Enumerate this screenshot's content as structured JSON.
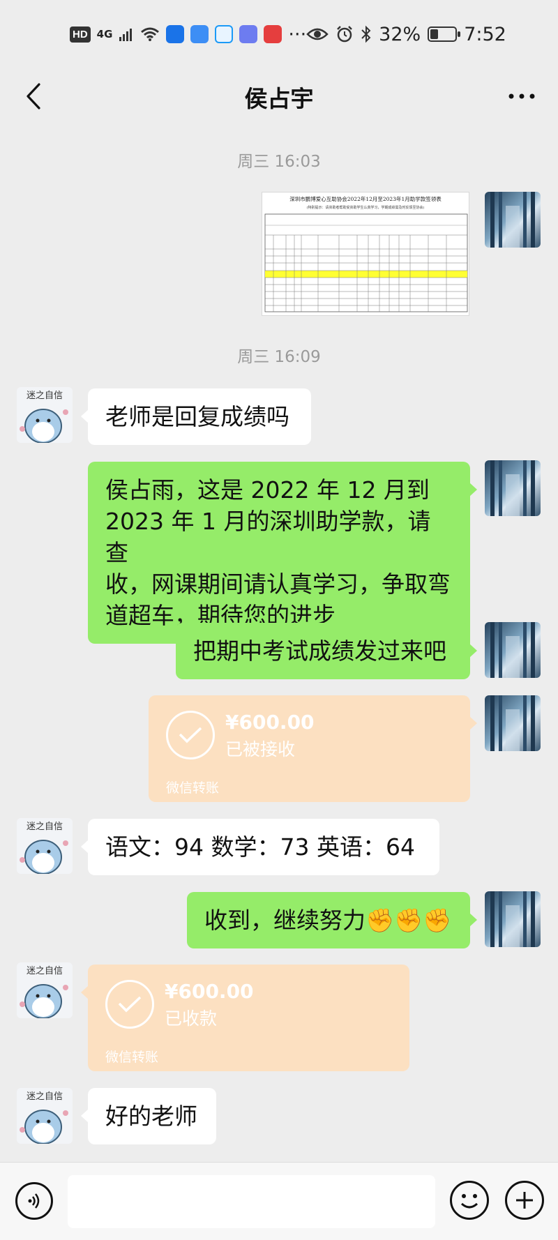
{
  "status_bar": {
    "hd": "HD",
    "network": "4G",
    "more": "···",
    "battery_text": "32%",
    "battery_level": 0.32,
    "time": "7:52"
  },
  "header": {
    "title": "侯占宇",
    "back_icon": "chevron-left-icon",
    "more_icon": "more-dots-icon"
  },
  "messages": {
    "time1": "周三 16:03",
    "doc_title": "深圳市鹏博爱心互助协会2022年12月至2023年1月助学款签领表",
    "doc_subtitle": "(特别提示：请资助者帮助受资助学生认真学习，学期成绩需及时反馈至协会)",
    "time2": "周三 16:09",
    "m1": "老师是回复成绩吗",
    "m2_line1": "侯占雨，这是 2022 年 12 月到",
    "m2_line2": "2023 年 1 月的深圳助学款，请查",
    "m2_line3": "收，网课期间请认真学习，争取弯",
    "m2_line4": "道超车，期待您的进步",
    "m3": "把期中考试成绩发过来吧",
    "t1_amount": "¥600.00",
    "t1_status": "已被接收",
    "t1_footer": "微信转账",
    "m4": "语文：94  数学：73  英语：64",
    "m5": "收到，继续努力✊✊✊",
    "t2_amount": "¥600.00",
    "t2_status": "已收款",
    "t2_footer": "微信转账",
    "m6": "好的老师",
    "avatar_sticker_text": "迷之自信"
  },
  "input": {
    "placeholder": "",
    "voice_icon": "voice-icon",
    "emoji_icon": "emoji-icon",
    "plus_icon": "plus-icon"
  }
}
